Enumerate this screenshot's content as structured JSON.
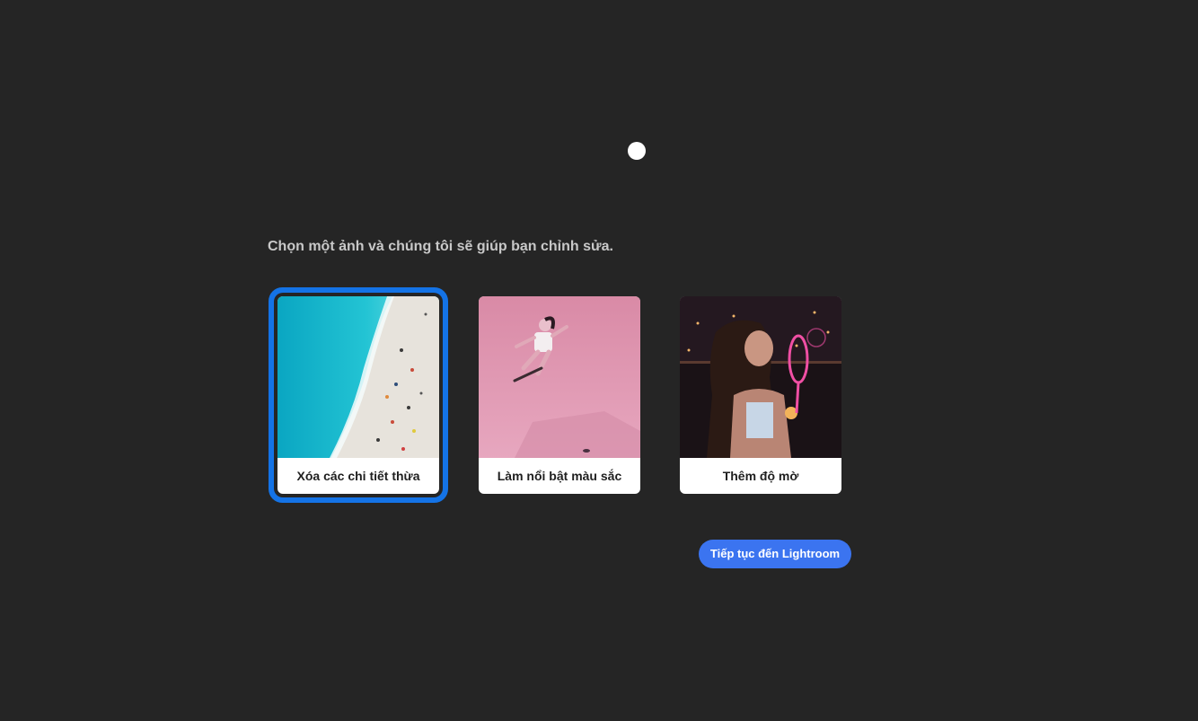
{
  "loader": {
    "icon": "loading-dot"
  },
  "prompt": "Chọn một ảnh và chúng tôi sẽ giúp bạn chỉnh sửa.",
  "cards": [
    {
      "label": "Xóa các chi tiết thừa",
      "image": "aerial-beach-photo",
      "selected": true
    },
    {
      "label": "Làm nổi bật màu sắc",
      "image": "pink-skateboarder-photo",
      "selected": false
    },
    {
      "label": "Thêm độ mờ",
      "image": "woman-blowing-bubbles-night-photo",
      "selected": false
    }
  ],
  "continue_button": {
    "label": "Tiếp tục đến Lightroom"
  },
  "colors": {
    "background": "#252525",
    "selection_ring": "#1473e6",
    "button": "#3b74f0",
    "prompt_text": "#c8c8c8"
  }
}
